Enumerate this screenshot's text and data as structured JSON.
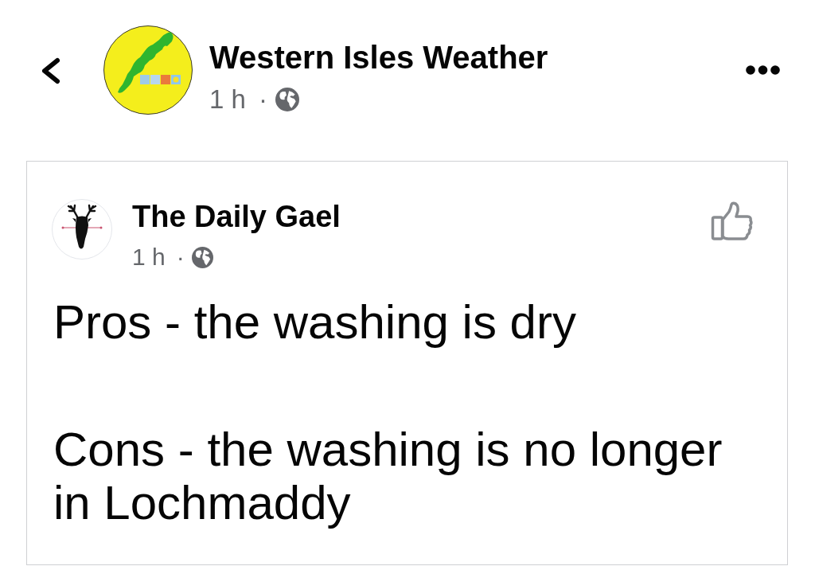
{
  "header": {
    "page_name": "Western Isles Weather",
    "time": "1 h",
    "separator": "·"
  },
  "shared_post": {
    "author": "The Daily Gael",
    "time": "1 h",
    "separator": "·",
    "paragraphs": [
      "Pros - the washing is dry",
      "Cons - the washing is no longer in Lochmaddy"
    ]
  }
}
